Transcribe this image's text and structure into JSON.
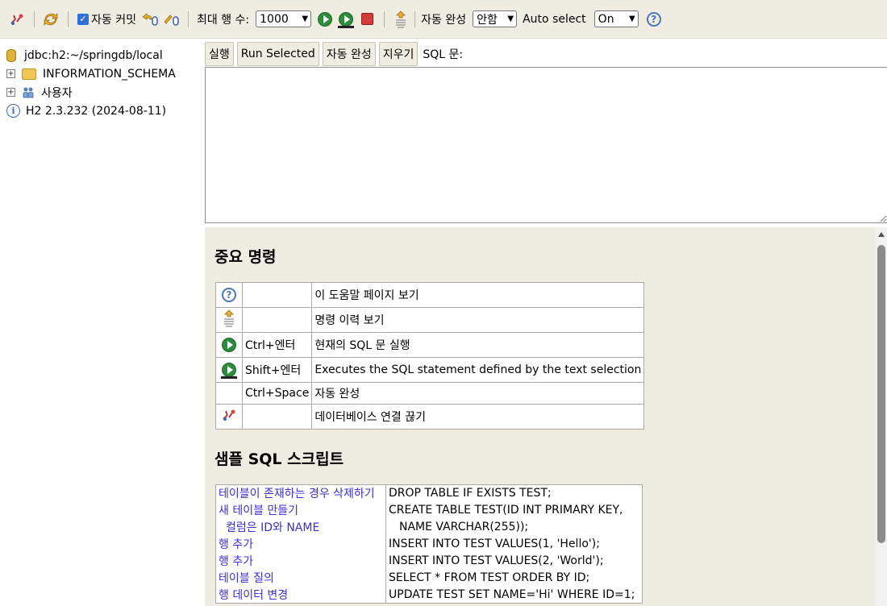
{
  "toolbar": {
    "autocommit_label": "자동 커밋",
    "max_rows_label": "최대 행 수:",
    "max_rows_value": "1000",
    "autocomplete_label": "자동 완성",
    "autocomplete_value": "안함",
    "autoselect_label": "Auto select",
    "autoselect_value": "On"
  },
  "tree": {
    "connection": "jdbc:h2:~/springdb/local",
    "items": [
      {
        "label": "INFORMATION_SCHEMA"
      },
      {
        "label": "사용자"
      }
    ],
    "version": "H2 2.3.232 (2024-08-11)"
  },
  "query": {
    "buttons": [
      "실행",
      "Run Selected",
      "자동 완성",
      "지우기"
    ],
    "sql_label": "SQL 문:",
    "sql_value": ""
  },
  "help": {
    "important_title": "중요 명령",
    "commands": [
      {
        "icon": "help-icon",
        "key": "",
        "desc": "이 도움말 페이지 보기"
      },
      {
        "icon": "history-icon",
        "key": "",
        "desc": "명령 이력 보기"
      },
      {
        "icon": "run-icon",
        "key": "Ctrl+엔터",
        "desc": "현재의 SQL 문 실행"
      },
      {
        "icon": "run-selected-icon",
        "key": "Shift+엔터",
        "desc": "Executes the SQL statement defined by the text selection"
      },
      {
        "icon": "",
        "key": "Ctrl+Space",
        "desc": "자동 완성"
      },
      {
        "icon": "disconnect-icon",
        "key": "",
        "desc": "데이터베이스 연결 끊기"
      }
    ],
    "sample_title": "샘플 SQL 스크립트",
    "samples": [
      {
        "desc": "테이블이 존재하는 경우 삭제하기",
        "code": "DROP TABLE IF EXISTS TEST;"
      },
      {
        "desc": "새 테이블 만들기",
        "code": "CREATE TABLE TEST(ID INT PRIMARY KEY,"
      },
      {
        "desc": "컬럼은 ID와 NAME",
        "code": "NAME VARCHAR(255));"
      },
      {
        "desc": "행 추가",
        "code": "INSERT INTO TEST VALUES(1, 'Hello');"
      },
      {
        "desc": "행 추가",
        "code": "INSERT INTO TEST VALUES(2, 'World');"
      },
      {
        "desc": "테이블 질의",
        "code": "SELECT * FROM TEST ORDER BY ID;"
      },
      {
        "desc": "행 데이터 변경",
        "code": "UPDATE TEST SET NAME='Hi' WHERE ID=1;"
      }
    ]
  }
}
